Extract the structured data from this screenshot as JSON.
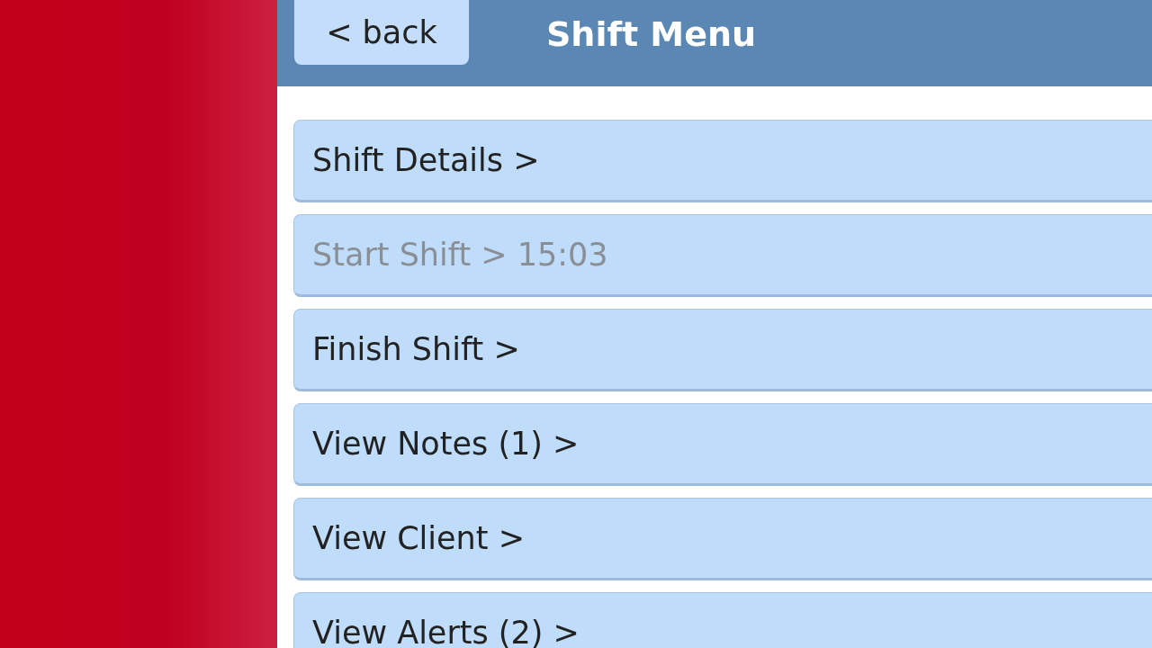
{
  "header": {
    "back_button": "< back",
    "title": "Shift Menu"
  },
  "menu_items": [
    {
      "label": "Shift Details >",
      "disabled": false
    },
    {
      "label": "Start Shift > 15:03",
      "disabled": true
    },
    {
      "label": "Finish Shift >",
      "disabled": false
    },
    {
      "label": "View Notes (1) >",
      "disabled": false
    },
    {
      "label": "View Client >",
      "disabled": false
    },
    {
      "label": "View Alerts (2) >",
      "disabled": false
    }
  ]
}
